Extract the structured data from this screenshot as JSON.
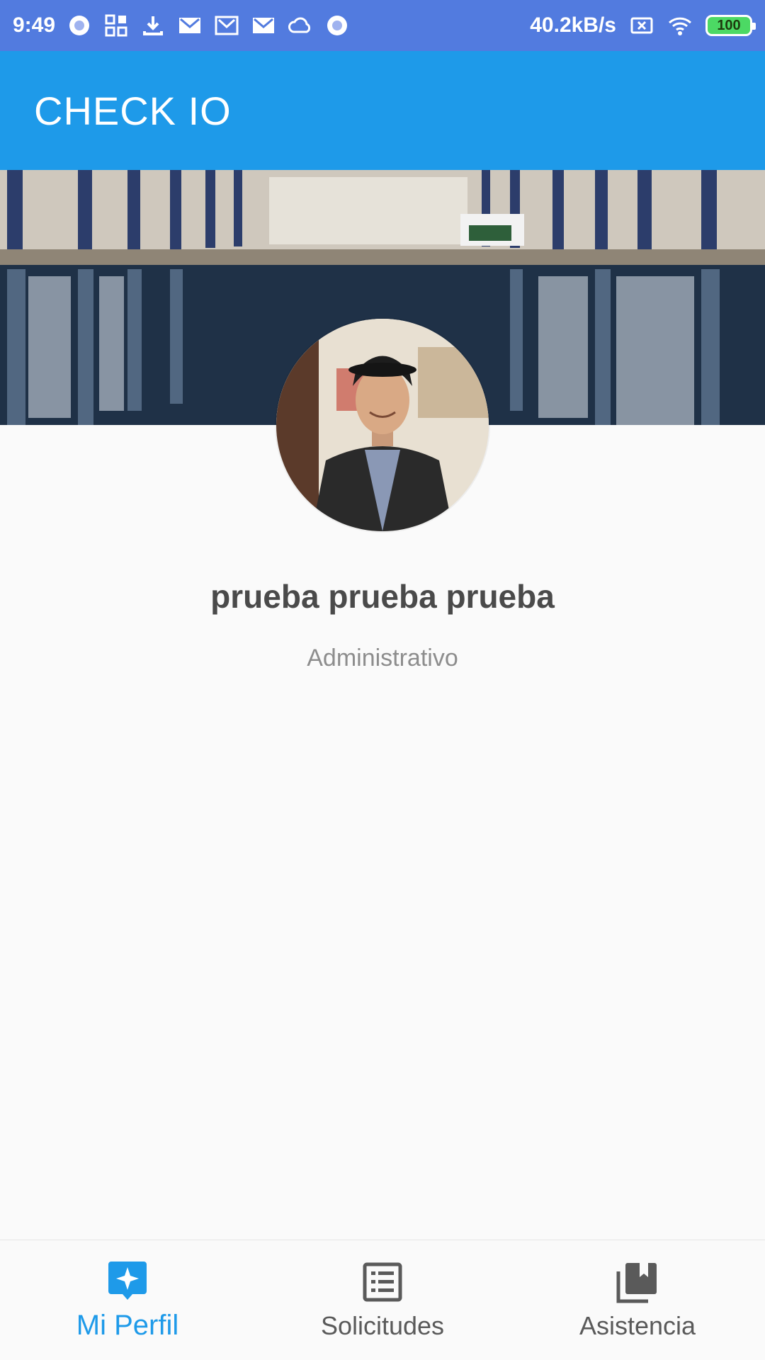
{
  "status_bar": {
    "time": "9:49",
    "network_speed": "40.2kB/s",
    "battery_level": "100",
    "left_icons": [
      "circle-icon",
      "grid-icon",
      "download-icon",
      "mail-icon",
      "mail-outline-icon",
      "mail-icon",
      "cloud-icon",
      "circle-icon"
    ],
    "right_icons": [
      "no-sim-icon",
      "wifi-icon",
      "battery-icon"
    ]
  },
  "app_bar": {
    "title": "CHECK IO",
    "color": "#1e9ae9"
  },
  "profile": {
    "name": "prueba prueba prueba",
    "role": "Administrativo"
  },
  "bottom_nav": {
    "items": [
      {
        "label": "Mi Perfil",
        "icon": "sparkle-icon",
        "active": true
      },
      {
        "label": "Solicitudes",
        "icon": "list-icon",
        "active": false
      },
      {
        "label": "Asistencia",
        "icon": "library-bookmark-icon",
        "active": false
      }
    ],
    "active_color": "#1e9ae9"
  }
}
